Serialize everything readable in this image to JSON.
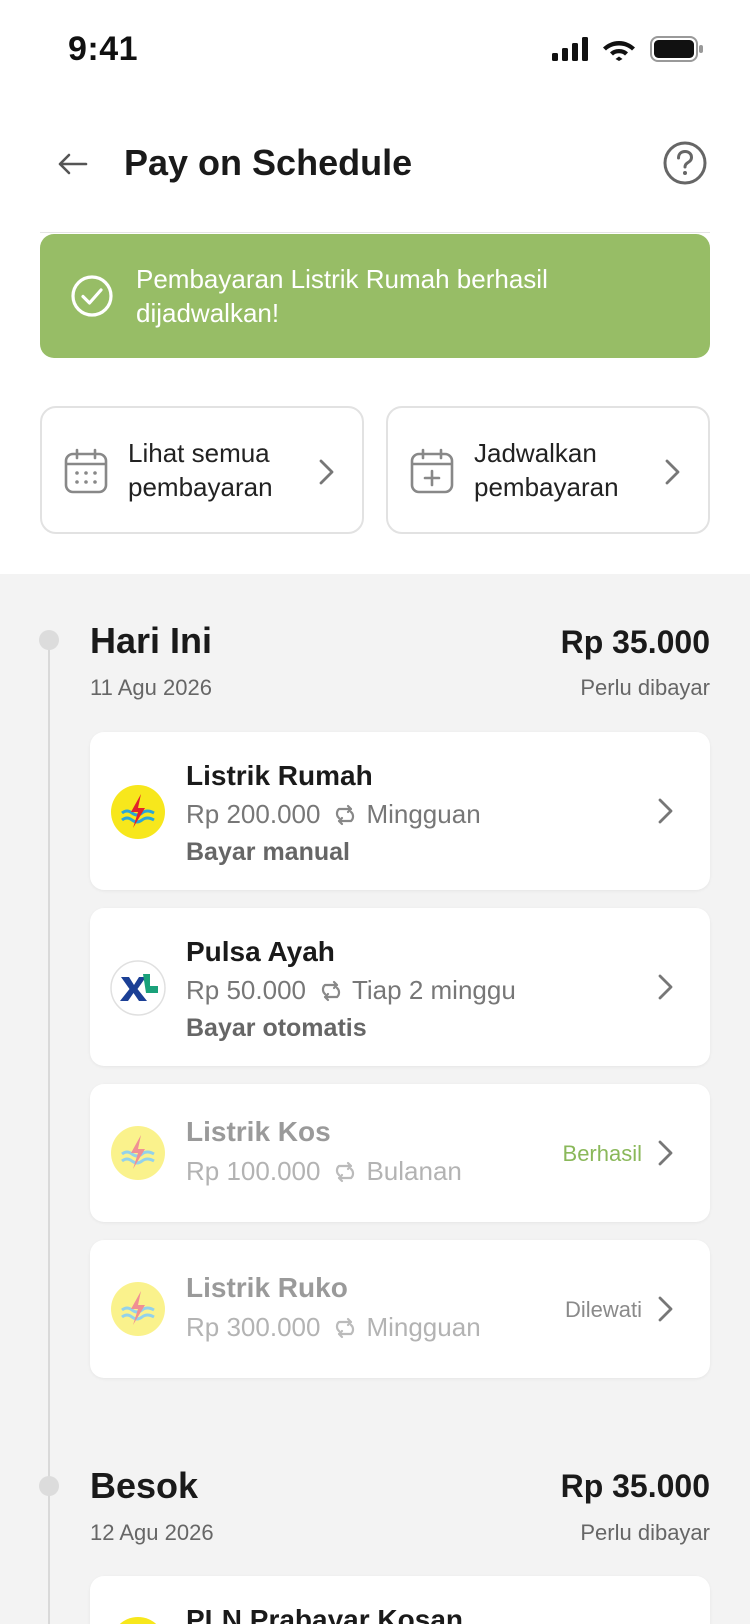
{
  "status_bar": {
    "time": "9:41"
  },
  "header": {
    "title": "Pay on Schedule"
  },
  "toast": {
    "message": "Pembayaran Listrik Rumah berhasil dijadwalkan!",
    "color": "#97bd66"
  },
  "actions": [
    {
      "label": "Lihat semua pembayaran",
      "icon": "calendar-icon"
    },
    {
      "label": "Jadwalkan pembayaran",
      "icon": "calendar-add-icon"
    }
  ],
  "sections": [
    {
      "title": "Hari Ini",
      "date": "11 Agu 2026",
      "amount": "Rp 35.000",
      "status": "Perlu dibayar",
      "bills": [
        {
          "name": "Listrik Rumah",
          "amount": "Rp 200.000",
          "frequency": "Mingguan",
          "method": "Bayar manual",
          "logo": "pln-logo"
        },
        {
          "name": "Pulsa Ayah",
          "amount": "Rp 50.000",
          "frequency": "Tiap 2 minggu",
          "method": "Bayar otomatis",
          "logo": "xl-logo"
        },
        {
          "name": "Listrik Kos",
          "amount": "Rp 100.000",
          "frequency": "Bulanan",
          "badge": "Berhasil",
          "badge_color": "#8ab85a",
          "logo": "pln-logo"
        },
        {
          "name": "Listrik Ruko",
          "amount": "Rp 300.000",
          "frequency": "Mingguan",
          "badge": "Dilewati",
          "badge_color": "#8a8a8a",
          "logo": "pln-logo"
        }
      ]
    },
    {
      "title": "Besok",
      "date": "12 Agu 2026",
      "amount": "Rp 35.000",
      "status": "Perlu dibayar",
      "bills": [
        {
          "name": "PLN Prabayar Kosan",
          "logo": "pln-logo"
        }
      ]
    }
  ]
}
